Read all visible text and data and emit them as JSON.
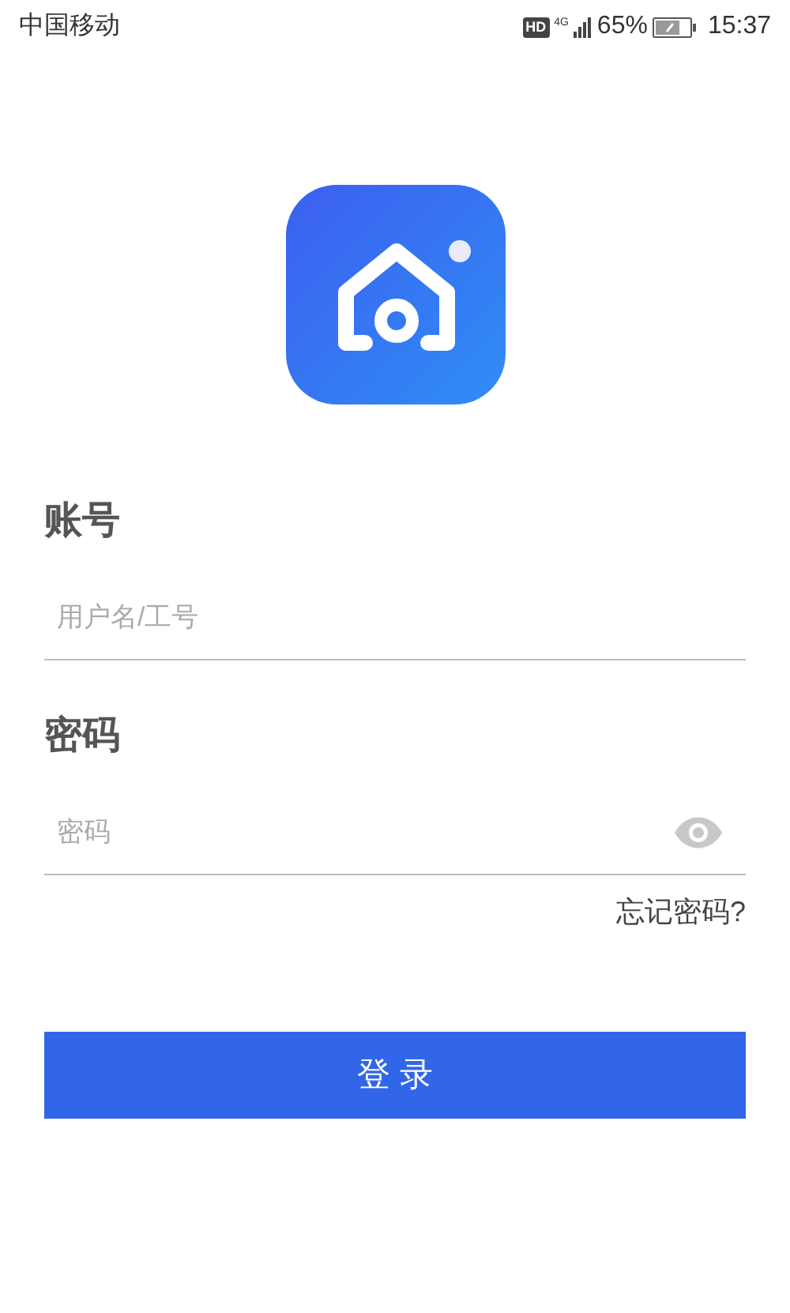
{
  "status_bar": {
    "carrier": "中国移动",
    "hd_badge": "HD",
    "network": "4G",
    "battery_percent": "65%",
    "time": "15:37"
  },
  "login_form": {
    "account": {
      "label": "账号",
      "placeholder": "用户名/工号"
    },
    "password": {
      "label": "密码",
      "placeholder": "密码"
    },
    "forgot_password": "忘记密码?",
    "submit": "登 录"
  }
}
